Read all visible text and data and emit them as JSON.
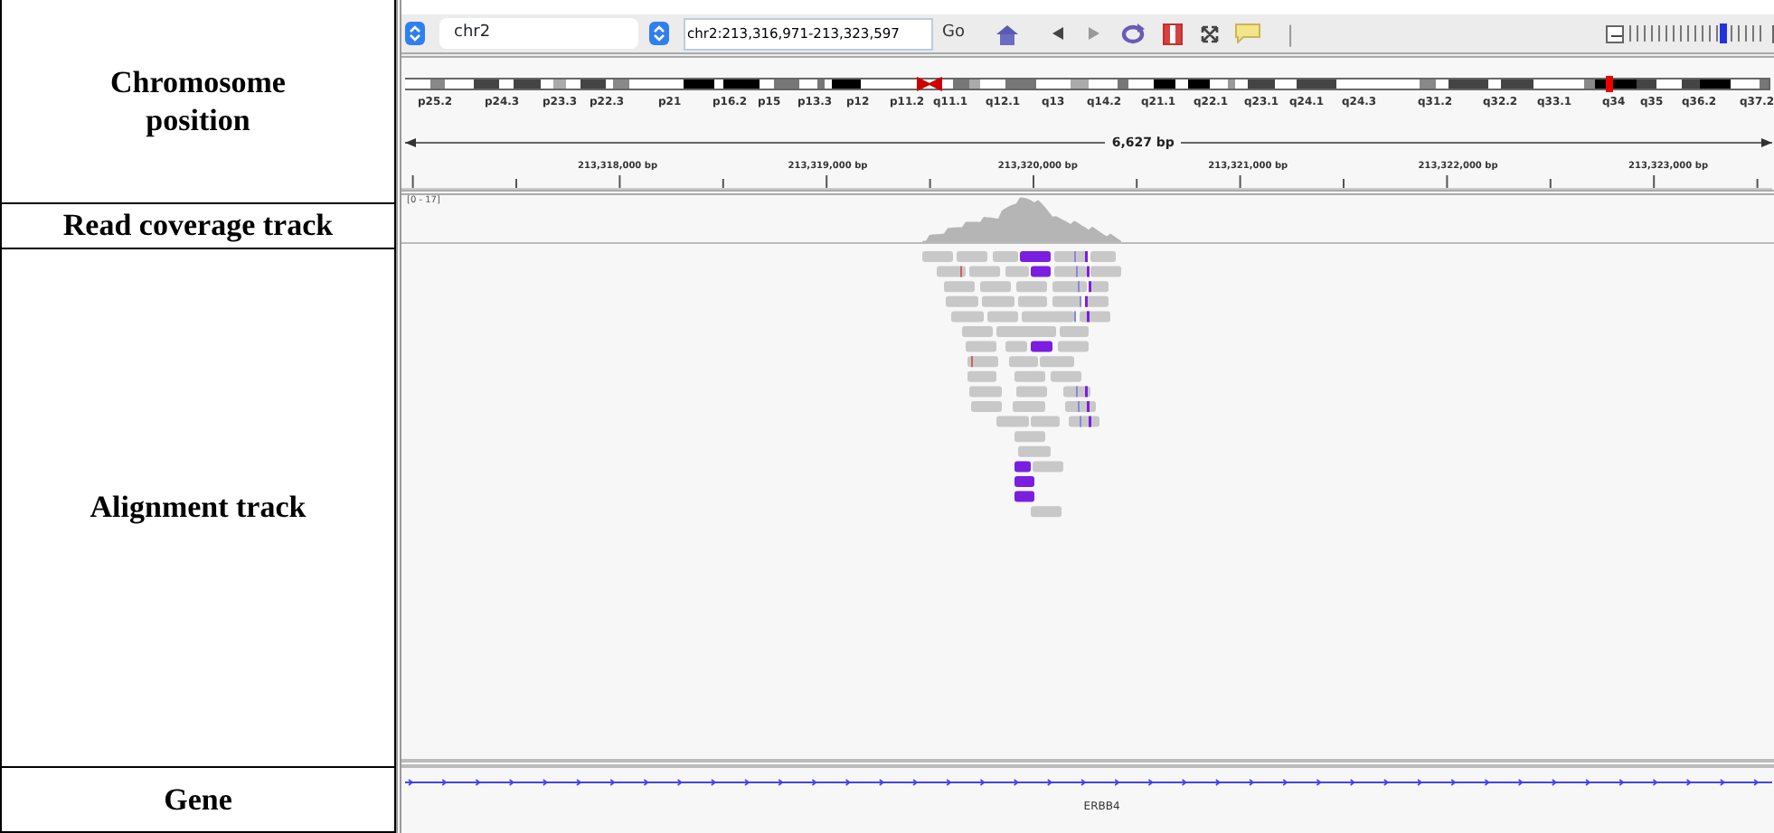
{
  "row_labels": [
    "Chromosome position",
    "Read coverage track",
    "Alignment track",
    "Gene"
  ],
  "toolbar": {
    "chromosome": "chr2",
    "locus": "chr2:213,316,971-213,323,597",
    "go_button": "Go",
    "divider": "|",
    "zoom": {
      "level": 0.69
    }
  },
  "ideogram": {
    "bands": [
      "p25.2",
      "p24.3",
      "p23.3",
      "p22.3",
      "p21",
      "p16.2",
      "p15",
      "p13.3",
      "p12",
      "p11.2",
      "q11.1",
      "q12.1",
      "q13",
      "q14.2",
      "q21.1",
      "q22.1",
      "q23.1",
      "q24.1",
      "q24.3",
      "q31.2",
      "q32.2",
      "q33.1",
      "q34",
      "q35",
      "q36.2",
      "q37.2"
    ]
  },
  "ruler": {
    "span": "6,627 bp",
    "ticks": [
      "213,318,000 bp",
      "213,319,000 bp",
      "213,320,000 bp",
      "213,321,000 bp",
      "213,322,000 bp",
      "213,323,000 bp"
    ]
  },
  "coverage": {
    "range": "[0 - 17]"
  },
  "gene": {
    "name": "ERBB4"
  }
}
